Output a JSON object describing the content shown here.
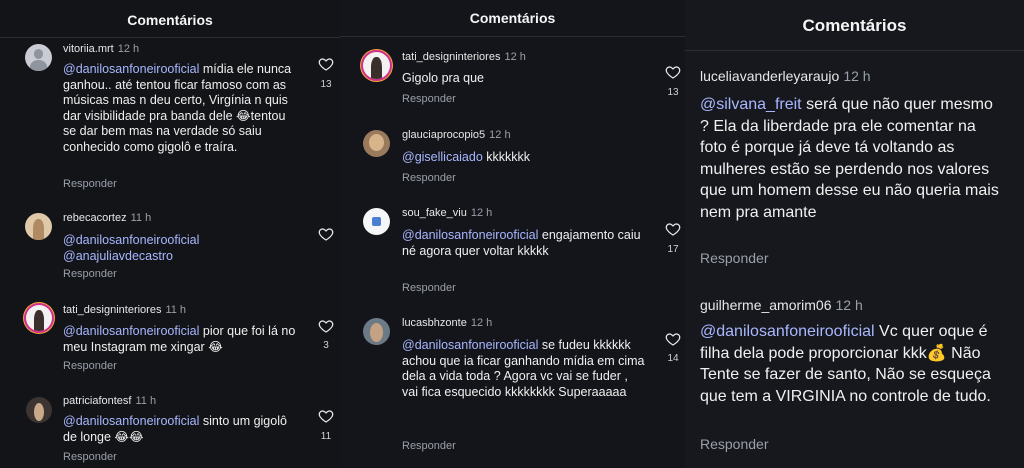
{
  "panel1": {
    "title": "Comentários",
    "comments": [
      {
        "user": "vitoriia.mrt",
        "time": "12 h",
        "mention": "@danilosanfoneirooficial",
        "text": " mídia ele nunca ganhou.. até tentou ficar famoso com as músicas mas n deu certo, Virgínia n quis dar visibilidade pra banda dele 😂tentou se dar bem mas na verdade só saiu conhecido como gigolô e traíra.",
        "reply": "Responder",
        "likes": "13"
      },
      {
        "user": "rebecacortez",
        "time": "11 h",
        "mention": "@danilosanfoneirooficial",
        "text": " @anajuliavdecastro",
        "reply": "Responder",
        "likes": ""
      },
      {
        "user": "tati_designinteriores",
        "time": "11 h",
        "mention": "@danilosanfoneirooficial",
        "text": " pior que foi lá no meu Instagram me xingar 😂",
        "reply": "Responder",
        "likes": "3"
      },
      {
        "user": "patriciafontesf",
        "time": "11 h",
        "mention": "@danilosanfoneirooficial",
        "text": " sinto um gigolô de longe 😂😂",
        "reply": "Responder",
        "likes": "11"
      }
    ]
  },
  "panel2": {
    "title": "Comentários",
    "comments": [
      {
        "user": "tati_designinteriores",
        "time": "12 h",
        "mention": "",
        "text": "Gigolo pra que",
        "reply": "Responder",
        "likes": "13"
      },
      {
        "user": "glauciaprocopio5",
        "time": "12 h",
        "mention": "@gisellicaiado",
        "text": " kkkkkkk",
        "reply": "Responder",
        "likes": ""
      },
      {
        "user": "sou_fake_viu",
        "time": "12 h",
        "mention": "@danilosanfoneirooficial",
        "text": " engajamento caiu né agora quer voltar kkkkk",
        "reply": "Responder",
        "likes": "17"
      },
      {
        "user": "lucasbhzonte",
        "time": "12 h",
        "mention": "@danilosanfoneirooficial",
        "text": " se fudeu kkkkkk achou que ia ficar ganhando mídia em cima dela a vida toda ? Agora vc vai se fuder , vai fica esquecido kkkkkkkk Superaaaaa",
        "reply": "Responder",
        "likes": "14"
      }
    ]
  },
  "panel3": {
    "title": "Comentários",
    "comments": [
      {
        "user": "luceliavanderleyaraujo",
        "time": "12 h",
        "mention": "@silvana_freit",
        "text": " será que não quer mesmo ? Ela da liberdade pra ele comentar na foto é porque já deve tá voltando as mulheres estão se perdendo nos valores que um homem desse eu não queria mais nem pra amante",
        "reply": "Responder"
      },
      {
        "user": "guilherme_amorim06",
        "time": "12 h",
        "mention": "@danilosanfoneirooficial",
        "text": " Vc quer oque é filha dela pode proporcionar kkk💰 Não Tente se fazer de santo, Não se esqueça que tem a VIRGINIA no controle de tudo.",
        "reply": "Responder"
      }
    ]
  },
  "colors": {
    "background": "#121418",
    "mention": "#a9b7ff",
    "muted": "#9aa0a8",
    "story_ring": "#d02f8c"
  },
  "icons": {
    "like": "heart-outline-icon",
    "avatar_default": "default-avatar-icon"
  }
}
